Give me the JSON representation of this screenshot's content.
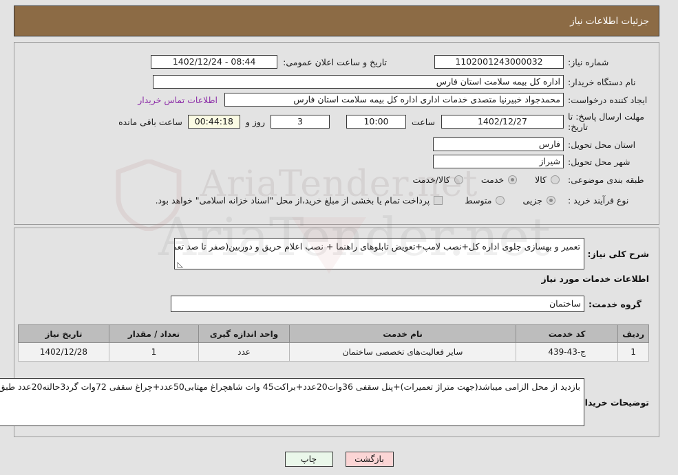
{
  "header": {
    "title": "جزئیات اطلاعات نیاز"
  },
  "top_form": {
    "need_number_label": "شماره نیاز:",
    "need_number_value": "1102001243000032",
    "public_announce_label": "تاریخ و ساعت اعلان عمومی:",
    "public_announce_value": "08:44 - 1402/12/24",
    "buyer_org_label": "نام دستگاه خریدار:",
    "buyer_org_value": "اداره کل بیمه سلامت استان فارس",
    "creator_label": "ایجاد کننده درخواست:",
    "creator_value": "محمدجواد خبیرنیا متصدی خدمات اداری اداره کل بیمه سلامت استان فارس",
    "contact_link": "اطلاعات تماس خریدار",
    "deadline_label": "مهلت ارسال پاسخ: تا تاریخ:",
    "deadline_date": "1402/12/27",
    "deadline_hour_label": "ساعت",
    "deadline_hour": "10:00",
    "days_remaining": "3",
    "days_word": "روز و",
    "countdown": "00:44:18",
    "countdown_suffix": "ساعت باقی مانده",
    "province_label": "استان محل تحویل:",
    "province_value": "فارس",
    "city_label": "شهر محل تحویل:",
    "city_value": "شیراز",
    "category_label": "طبقه بندی موضوعی:",
    "category_options": [
      "کالا",
      "خدمت",
      "کالا/خدمت"
    ],
    "category_selected": "خدمت",
    "process_label": "نوع فرآیند خرید :",
    "process_options": [
      "جزیی",
      "متوسط"
    ],
    "process_selected": "جزیی",
    "treasury_checkbox_text": "پرداخت تمام یا بخشی از مبلغ خرید،از محل \"اسناد خزانه اسلامی\" خواهد بود.",
    "treasury_checked": false
  },
  "description": {
    "label": "شرح کلی نیاز:",
    "value": "تعمیر و بهسازی جلوی اداره کل+نصب لامپ+تعویض تابلوهای راهنما + نصب اعلام حریق و دوربین(صفر تا صد تعمیرات و تامین مصالح و خرید کالا با برنده استعلام)"
  },
  "services_section": {
    "heading": "اطلاعات خدمات مورد نیاز",
    "group_label": "گروه خدمت:",
    "group_value": "ساختمان"
  },
  "table": {
    "headers": [
      "ردیف",
      "کد خدمت",
      "نام خدمت",
      "واحد اندازه گیری",
      "تعداد / مقدار",
      "تاریخ نیاز"
    ],
    "rows": [
      {
        "row_no": "1",
        "service_code": "ج-43-439",
        "service_name": "سایر فعالیت‌های تخصصی ساختمان",
        "unit": "عدد",
        "quantity": "1",
        "need_date": "1402/12/28"
      }
    ]
  },
  "buyer_notes": {
    "label": "توضیحات خریدار:",
    "value": "بازدید از محل الزامی میباشد(جهت متراژ تعمیرات)+پنل سقفی 36وات20عدد+براکت45 وات شاهچراغ مهتابی50عدد+چراغ سقفی 72وات گرد3حالته20عدد طبق تصاویر پیوست"
  },
  "footer": {
    "print_label": "چاپ",
    "back_label": "بازگشت"
  },
  "watermark": {
    "text": "AriaTender.net"
  },
  "colors": {
    "header_bg": "#8c6b45",
    "panel_bg": "#e3e3e3",
    "link": "#8d2fa8",
    "countdown_bg": "#fbfbe4",
    "table_header_bg": "#bdbdbd",
    "btn_print_bg": "#eaf7ea",
    "btn_back_bg": "#fbd5d5"
  }
}
